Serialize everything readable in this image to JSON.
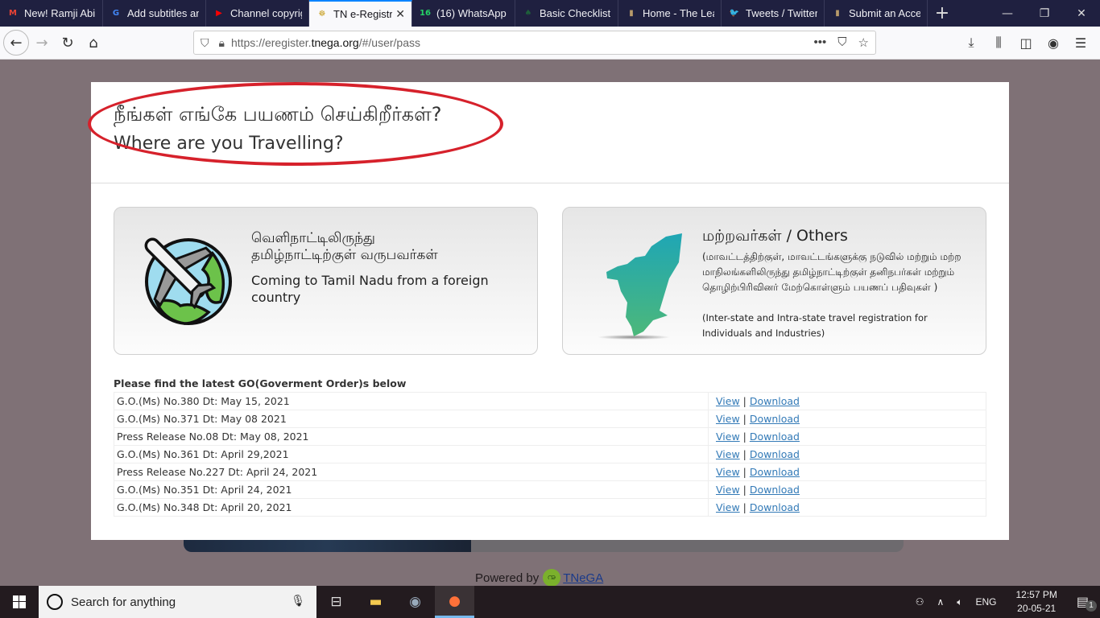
{
  "browser": {
    "tabs": [
      {
        "label": "New! Ramji Abili",
        "icon": "gmail-icon",
        "glyph": "M",
        "color": "#ea4335",
        "active": false
      },
      {
        "label": "Add subtitles an",
        "icon": "google-icon",
        "glyph": "G",
        "color": "#4285f4",
        "active": false
      },
      {
        "label": "Channel copyrig",
        "icon": "youtube-icon",
        "glyph": "▶",
        "color": "#ff0000",
        "active": false
      },
      {
        "label": "TN e-Registra",
        "icon": "tn-emblem-icon",
        "glyph": "☸",
        "color": "#c9a227",
        "active": true
      },
      {
        "label": "(16) WhatsApp",
        "icon": "whatsapp-icon",
        "glyph": "16",
        "color": "#25d366",
        "active": false
      },
      {
        "label": "Basic Checklist: (",
        "icon": "checklist-site-icon",
        "glyph": "♠",
        "color": "#1e5f3a",
        "active": false
      },
      {
        "label": "Home - The Lea",
        "icon": "door-icon",
        "glyph": "▮",
        "color": "#b89b6a",
        "active": false
      },
      {
        "label": "Tweets / Twitter",
        "icon": "twitter-icon",
        "glyph": "🐦",
        "color": "#1da1f2",
        "active": false
      },
      {
        "label": "Submit an Acces",
        "icon": "door-icon",
        "glyph": "▮",
        "color": "#b89b6a",
        "active": false
      }
    ],
    "new_tab": "+",
    "url_prefix": "https://eregister.",
    "url_domain": "tnega.org",
    "url_suffix": "/#/user/pass"
  },
  "page": {
    "heading_ta": "நீங்கள் எங்கே பயணம் செய்கிறீர்கள்?",
    "heading_en": "Where are you Travelling?",
    "annotation_color": "#d6212b",
    "card_foreign": {
      "title_ta_1": "வெளிநாட்டிலிருந்து",
      "title_ta_2": "தமிழ்நாட்டிற்குள் வருபவர்கள்",
      "title_en": "Coming to Tamil Nadu from a foreign country"
    },
    "card_others": {
      "title": "மற்றவர்கள் / Others",
      "desc_ta": "(மாவட்டத்திற்குள், மாவட்டங்களுக்கு நடுவில் மற்றும் மற்ற மாநிலங்களிலிருந்து தமிழ்நாட்டிற்குள் தனிநபர்கள் மற்றும் தொழிற்பிரிவினர் மேற்கொள்ளும் பயணப் பதிவுகள் )",
      "desc_en": "(Inter-state and Intra-state travel registration for Individuals and Industries)"
    },
    "go_title": "Please find the latest GO(Goverment Order)s below",
    "go_rows": [
      {
        "name": "G.O.(Ms) No.380 Dt: May 15, 2021",
        "view": "View",
        "sep": "|",
        "download": "Download"
      },
      {
        "name": "G.O.(Ms) No.371 Dt: May 08 2021",
        "view": "View",
        "sep": "|",
        "download": "Download"
      },
      {
        "name": "Press Release No.08 Dt: May 08, 2021",
        "view": "View",
        "sep": "|",
        "download": "Download"
      },
      {
        "name": "G.O.(Ms) No.361 Dt: April 29,2021",
        "view": "View",
        "sep": "|",
        "download": "Download"
      },
      {
        "name": "Press Release No.227 Dt: April 24, 2021",
        "view": "View",
        "sep": "|",
        "download": "Download"
      },
      {
        "name": "G.O.(Ms) No.351 Dt: April 24, 2021",
        "view": "View",
        "sep": "|",
        "download": "Download"
      },
      {
        "name": "G.O.(Ms) No.348 Dt: April 20, 2021",
        "view": "View",
        "sep": "|",
        "download": "Download"
      }
    ],
    "powered_by": "Powered by",
    "powered_link": "TNeGA"
  },
  "taskbar": {
    "search_placeholder": "Search for anything",
    "language": "ENG",
    "time": "12:57 PM",
    "date": "20-05-21",
    "notification_count": "1"
  }
}
